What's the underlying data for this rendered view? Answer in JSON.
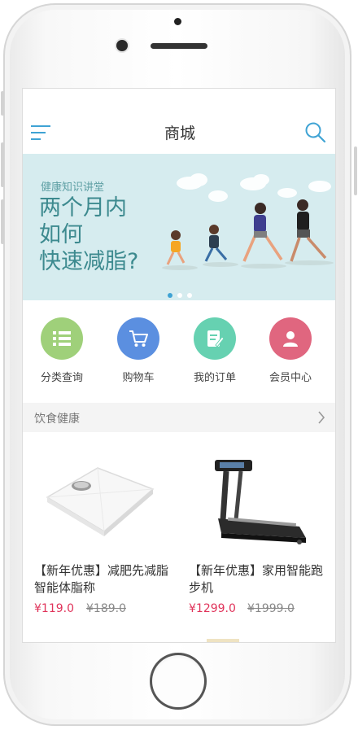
{
  "nav": {
    "title": "商城"
  },
  "banner": {
    "subtitle": "健康知识讲堂",
    "headline": "两个月内\n如何\n快速减脂?",
    "slides": 3,
    "active_slide": 1
  },
  "shortcuts": [
    {
      "label": "分类查询",
      "icon": "list-icon",
      "color": "#9fd07a"
    },
    {
      "label": "购物车",
      "icon": "cart-icon",
      "color": "#5b8fe0"
    },
    {
      "label": "我的订单",
      "icon": "order-icon",
      "color": "#66d1b1"
    },
    {
      "label": "会员中心",
      "icon": "member-icon",
      "color": "#e0667f"
    }
  ],
  "section": {
    "label": "饮食健康"
  },
  "products": [
    {
      "name": "【新年优惠】减肥先减脂智能体脂称",
      "price": "¥119.0",
      "old_price": "¥189.0",
      "image": "body-fat-scale"
    },
    {
      "name": "【新年优惠】家用智能跑步机",
      "price": "¥1299.0",
      "old_price": "¥1999.0",
      "image": "treadmill"
    }
  ],
  "colors": {
    "accent": "#3fa3d4",
    "price": "#e0335a",
    "banner_bg": "#d6ecef",
    "banner_text": "#3d8a8f"
  }
}
